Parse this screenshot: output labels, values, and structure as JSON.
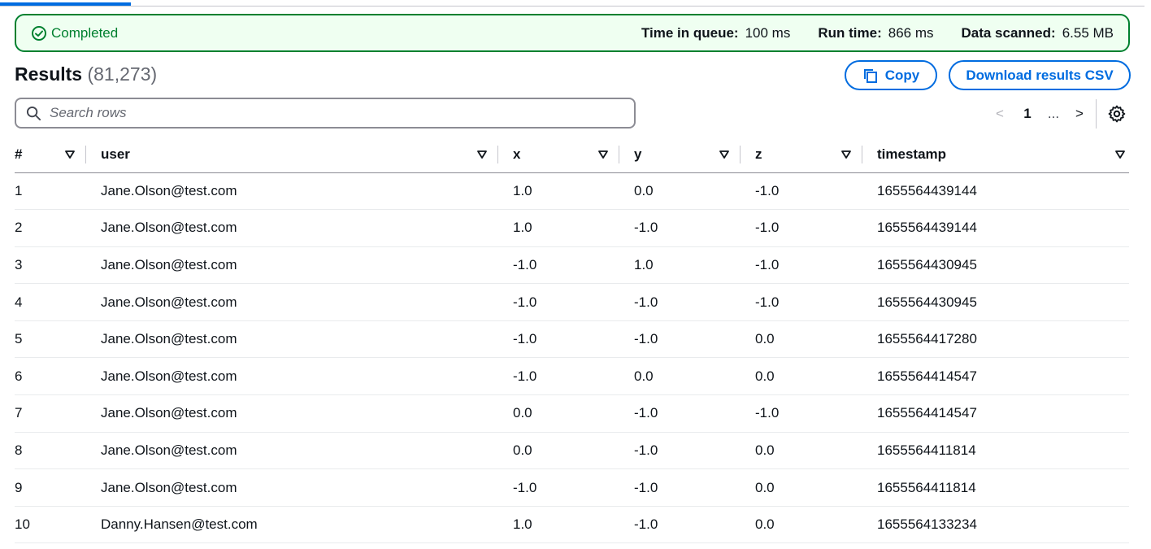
{
  "status": {
    "label": "Completed",
    "metrics": [
      {
        "label": "Time in queue:",
        "value": "100 ms"
      },
      {
        "label": "Run time:",
        "value": "866 ms"
      },
      {
        "label": "Data scanned:",
        "value": "6.55 MB"
      }
    ]
  },
  "results": {
    "title": "Results",
    "count": "(81,273)",
    "copy_label": "Copy",
    "download_label": "Download results CSV"
  },
  "search": {
    "placeholder": "Search rows"
  },
  "pagination": {
    "current": "1",
    "ellipsis": "...",
    "prev": "<",
    "next": ">"
  },
  "table": {
    "columns": [
      "#",
      "user",
      "x",
      "y",
      "z",
      "timestamp"
    ],
    "rows": [
      [
        "1",
        "Jane.Olson@test.com",
        "1.0",
        "0.0",
        "-1.0",
        "1655564439144"
      ],
      [
        "2",
        "Jane.Olson@test.com",
        "1.0",
        "-1.0",
        "-1.0",
        "1655564439144"
      ],
      [
        "3",
        "Jane.Olson@test.com",
        "-1.0",
        "1.0",
        "-1.0",
        "1655564430945"
      ],
      [
        "4",
        "Jane.Olson@test.com",
        "-1.0",
        "-1.0",
        "-1.0",
        "1655564430945"
      ],
      [
        "5",
        "Jane.Olson@test.com",
        "-1.0",
        "-1.0",
        "0.0",
        "1655564417280"
      ],
      [
        "6",
        "Jane.Olson@test.com",
        "-1.0",
        "0.0",
        "0.0",
        "1655564414547"
      ],
      [
        "7",
        "Jane.Olson@test.com",
        "0.0",
        "-1.0",
        "-1.0",
        "1655564414547"
      ],
      [
        "8",
        "Jane.Olson@test.com",
        "0.0",
        "-1.0",
        "0.0",
        "1655564411814"
      ],
      [
        "9",
        "Jane.Olson@test.com",
        "-1.0",
        "-1.0",
        "0.0",
        "1655564411814"
      ],
      [
        "10",
        "Danny.Hansen@test.com",
        "1.0",
        "-1.0",
        "0.0",
        "1655564133234"
      ]
    ]
  },
  "colors": {
    "success": "#00802f",
    "success_bg": "#effff1",
    "accent": "#006ce0"
  },
  "icons": [
    "check-circle-icon",
    "copy-icon",
    "search-icon",
    "chevron-left-icon",
    "chevron-right-icon",
    "gear-icon",
    "sort-down-icon"
  ]
}
